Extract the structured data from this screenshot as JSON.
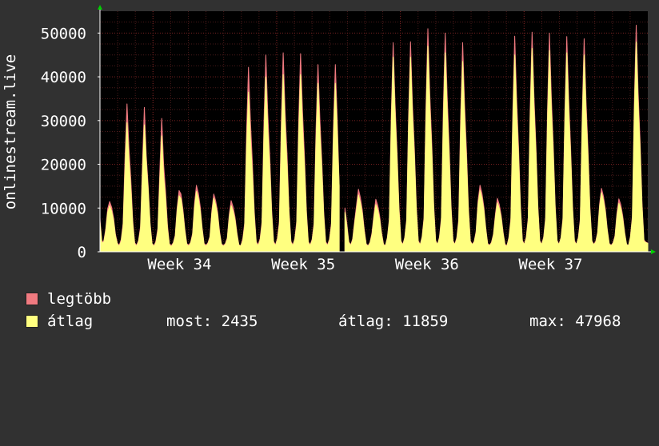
{
  "colors": {
    "background": "#313131",
    "plot_bg": "#000000",
    "grid_major": "#7a2222",
    "grid_minor": "#4a1a1a",
    "max_series": "#f07a80",
    "avg_series": "#ffff80",
    "text": "#ffffff",
    "arrow": "#00d000"
  },
  "legend": {
    "max_label": "legtöbb",
    "avg_label": "átlag",
    "now": "most: 2435",
    "avg": "átlag: 11859",
    "max": "max: 47968"
  },
  "chart_data": {
    "type": "area",
    "title": "",
    "xlabel": "",
    "ylabel": "onlinestream.live",
    "ylim": [
      0,
      55000
    ],
    "yticks": [
      "0",
      "10000",
      "20000",
      "30000",
      "40000",
      "50000"
    ],
    "xticks": [
      "Week 34",
      "Week 35",
      "Week 36",
      "Week 37"
    ],
    "grid": true,
    "x_unit": "day",
    "days": 31,
    "series": [
      {
        "name": "legtöbb",
        "color": "#f07a80",
        "daily_peaks": [
          11500,
          33800,
          33000,
          30500,
          14000,
          15200,
          13200,
          11700,
          42200,
          45000,
          45500,
          45300,
          42800,
          10000,
          14300,
          12000,
          47800,
          48000,
          51000,
          50000,
          47800,
          15200,
          12200,
          49300,
          50200,
          50000,
          49200,
          48700,
          14500,
          12100,
          51800
        ],
        "values": [
          7500,
          2200,
          2500,
          5200,
          9800,
          11500,
          10200,
          7900,
          4100,
          2000,
          1500,
          2800,
          6500,
          22000,
          33800,
          24000,
          16500,
          7200,
          2100,
          1500,
          2600,
          5800,
          20000,
          33000,
          22000,
          15100,
          6600,
          1900,
          1400,
          2400,
          5400,
          18400,
          30500,
          20000,
          13900,
          6100,
          1800,
          1400,
          2100,
          3800,
          10100,
          14000,
          13200,
          9800,
          5300,
          1900,
          1500,
          2200,
          4200,
          11000,
          15200,
          13400,
          10300,
          5500,
          1900,
          1500,
          2100,
          3500,
          9500,
          13200,
          11600,
          9100,
          4700,
          1800,
          1400,
          1900,
          3200,
          8500,
          11700,
          10300,
          8000,
          4300,
          1600,
          1400,
          2900,
          6600,
          27400,
          42200,
          30100,
          20700,
          9100,
          2300,
          1600,
          3000,
          6900,
          29300,
          45000,
          31700,
          21800,
          9600,
          2400,
          1600,
          3100,
          6900,
          29500,
          45500,
          32000,
          22000,
          9600,
          2400,
          1600,
          3000,
          7000,
          29500,
          45300,
          32000,
          21900,
          9600,
          2300,
          1600,
          2900,
          6600,
          27800,
          42800,
          30300,
          20800,
          9100,
          2300,
          1600,
          2900,
          6600,
          27800,
          42800,
          30300,
          15100,
          null,
          null,
          10000,
          6500,
          2300,
          1600,
          3000,
          7000,
          10700,
          14300,
          12400,
          9600,
          5200,
          1800,
          1400,
          2200,
          4300,
          8500,
          12000,
          10600,
          8200,
          4400,
          1700,
          1500,
          3300,
          7500,
          31000,
          47800,
          33800,
          23300,
          10300,
          2500,
          1700,
          3300,
          7500,
          31200,
          48000,
          33900,
          23400,
          10300,
          2500,
          1700,
          3500,
          7900,
          33100,
          51000,
          36100,
          24800,
          10900,
          2600,
          1700,
          3400,
          7800,
          32500,
          50000,
          35400,
          24300,
          10700,
          2600,
          1700,
          3300,
          7500,
          31100,
          47800,
          33800,
          23200,
          10200,
          2500,
          1700,
          2400,
          4700,
          11600,
          15200,
          13400,
          10300,
          5500,
          1900,
          1500,
          2200,
          4100,
          8700,
          12200,
          10800,
          8300,
          4500,
          1700,
          1400,
          3300,
          7700,
          32000,
          49300,
          34900,
          24000,
          10500,
          2600,
          1700,
          3400,
          7800,
          32600,
          50200,
          35500,
          24400,
          10700,
          2600,
          1700,
          3400,
          7800,
          32500,
          50000,
          35400,
          24300,
          10600,
          2600,
          1700,
          3300,
          7700,
          32000,
          49200,
          34800,
          23900,
          10500,
          2500,
          1700,
          3300,
          7600,
          31600,
          48700,
          34400,
          23600,
          10400,
          2500,
          1700,
          2400,
          4500,
          10900,
          14500,
          12700,
          9800,
          5200,
          1900,
          1500,
          2100,
          3700,
          8800,
          12100,
          10800,
          8300,
          4400,
          1700,
          1500,
          3500,
          8200,
          33700,
          51800,
          36600,
          25200,
          11100,
          2700,
          2200,
          2000
        ]
      },
      {
        "name": "átlag",
        "color": "#ffff80",
        "daily_peaks": [
          10500,
          29500,
          29000,
          26500,
          12800,
          13800,
          12200,
          10600,
          36500,
          40000,
          40500,
          40500,
          38500,
          9000,
          13000,
          10800,
          44500,
          44500,
          47000,
          45500,
          43500,
          14000,
          11200,
          45000,
          46500,
          46000,
          45500,
          45000,
          13500,
          11100,
          47968
        ],
        "values": [
          6800,
          2000,
          2200,
          4700,
          9000,
          10500,
          9300,
          7200,
          3700,
          1800,
          1300,
          2400,
          5700,
          19200,
          29500,
          21000,
          14400,
          6300,
          1800,
          1300,
          2300,
          5100,
          17600,
          29000,
          20500,
          14100,
          6100,
          1800,
          1200,
          2100,
          4700,
          16000,
          26500,
          17400,
          12100,
          5300,
          1600,
          1200,
          1900,
          3500,
          9300,
          12800,
          12100,
          9000,
          4800,
          1700,
          1300,
          2000,
          3800,
          10000,
          13800,
          12200,
          9300,
          5000,
          1700,
          1300,
          1900,
          3200,
          8800,
          12200,
          10700,
          8400,
          4300,
          1600,
          1300,
          1700,
          2900,
          7700,
          10600,
          9300,
          7300,
          3900,
          1500,
          1300,
          2500,
          5800,
          23700,
          36500,
          26000,
          17900,
          7900,
          2000,
          1400,
          2600,
          6100,
          26000,
          40000,
          28200,
          19400,
          8500,
          2100,
          1400,
          2800,
          6200,
          26300,
          40500,
          28500,
          19600,
          8600,
          2100,
          1400,
          2700,
          6200,
          26300,
          40500,
          28600,
          19600,
          8600,
          2100,
          1400,
          2600,
          5900,
          25000,
          38500,
          27200,
          18700,
          8200,
          2000,
          1400,
          2600,
          5900,
          25000,
          38500,
          27200,
          15100,
          null,
          null,
          9000,
          5800,
          2100,
          1400,
          2700,
          6400,
          9700,
          13000,
          11200,
          8700,
          4700,
          1600,
          1300,
          2000,
          3900,
          7700,
          10800,
          9600,
          7400,
          4000,
          1500,
          1400,
          3100,
          7000,
          28900,
          44500,
          31400,
          21600,
          9500,
          2300,
          1500,
          3100,
          7000,
          28900,
          44500,
          31400,
          21600,
          9500,
          2300,
          1500,
          3200,
          7300,
          30500,
          47000,
          33200,
          22800,
          10000,
          2400,
          1600,
          3100,
          7100,
          29600,
          45500,
          32200,
          22100,
          9700,
          2300,
          1600,
          3000,
          6800,
          28300,
          43500,
          30700,
          21100,
          9300,
          2300,
          1600,
          2200,
          4300,
          10700,
          14000,
          12300,
          9500,
          5100,
          1700,
          1400,
          2000,
          3800,
          8000,
          11200,
          9900,
          7600,
          4100,
          1500,
          1300,
          3000,
          7000,
          29200,
          45000,
          31800,
          21900,
          9600,
          2400,
          1600,
          3100,
          7200,
          30200,
          46500,
          32900,
          22600,
          9900,
          2400,
          1600,
          3100,
          7200,
          29900,
          46000,
          32500,
          22400,
          9800,
          2400,
          1600,
          3100,
          7100,
          29600,
          45500,
          32200,
          22100,
          9700,
          2300,
          1600,
          3100,
          7000,
          29300,
          45000,
          31800,
          21900,
          9600,
          2300,
          1600,
          2200,
          4200,
          10200,
          13500,
          11800,
          9100,
          4900,
          1700,
          1400,
          1900,
          3400,
          8100,
          11100,
          9900,
          7600,
          4100,
          1600,
          1400,
          3300,
          7600,
          31200,
          47968,
          33900,
          23300,
          10300,
          2400,
          2100,
          1900
        ]
      }
    ]
  }
}
